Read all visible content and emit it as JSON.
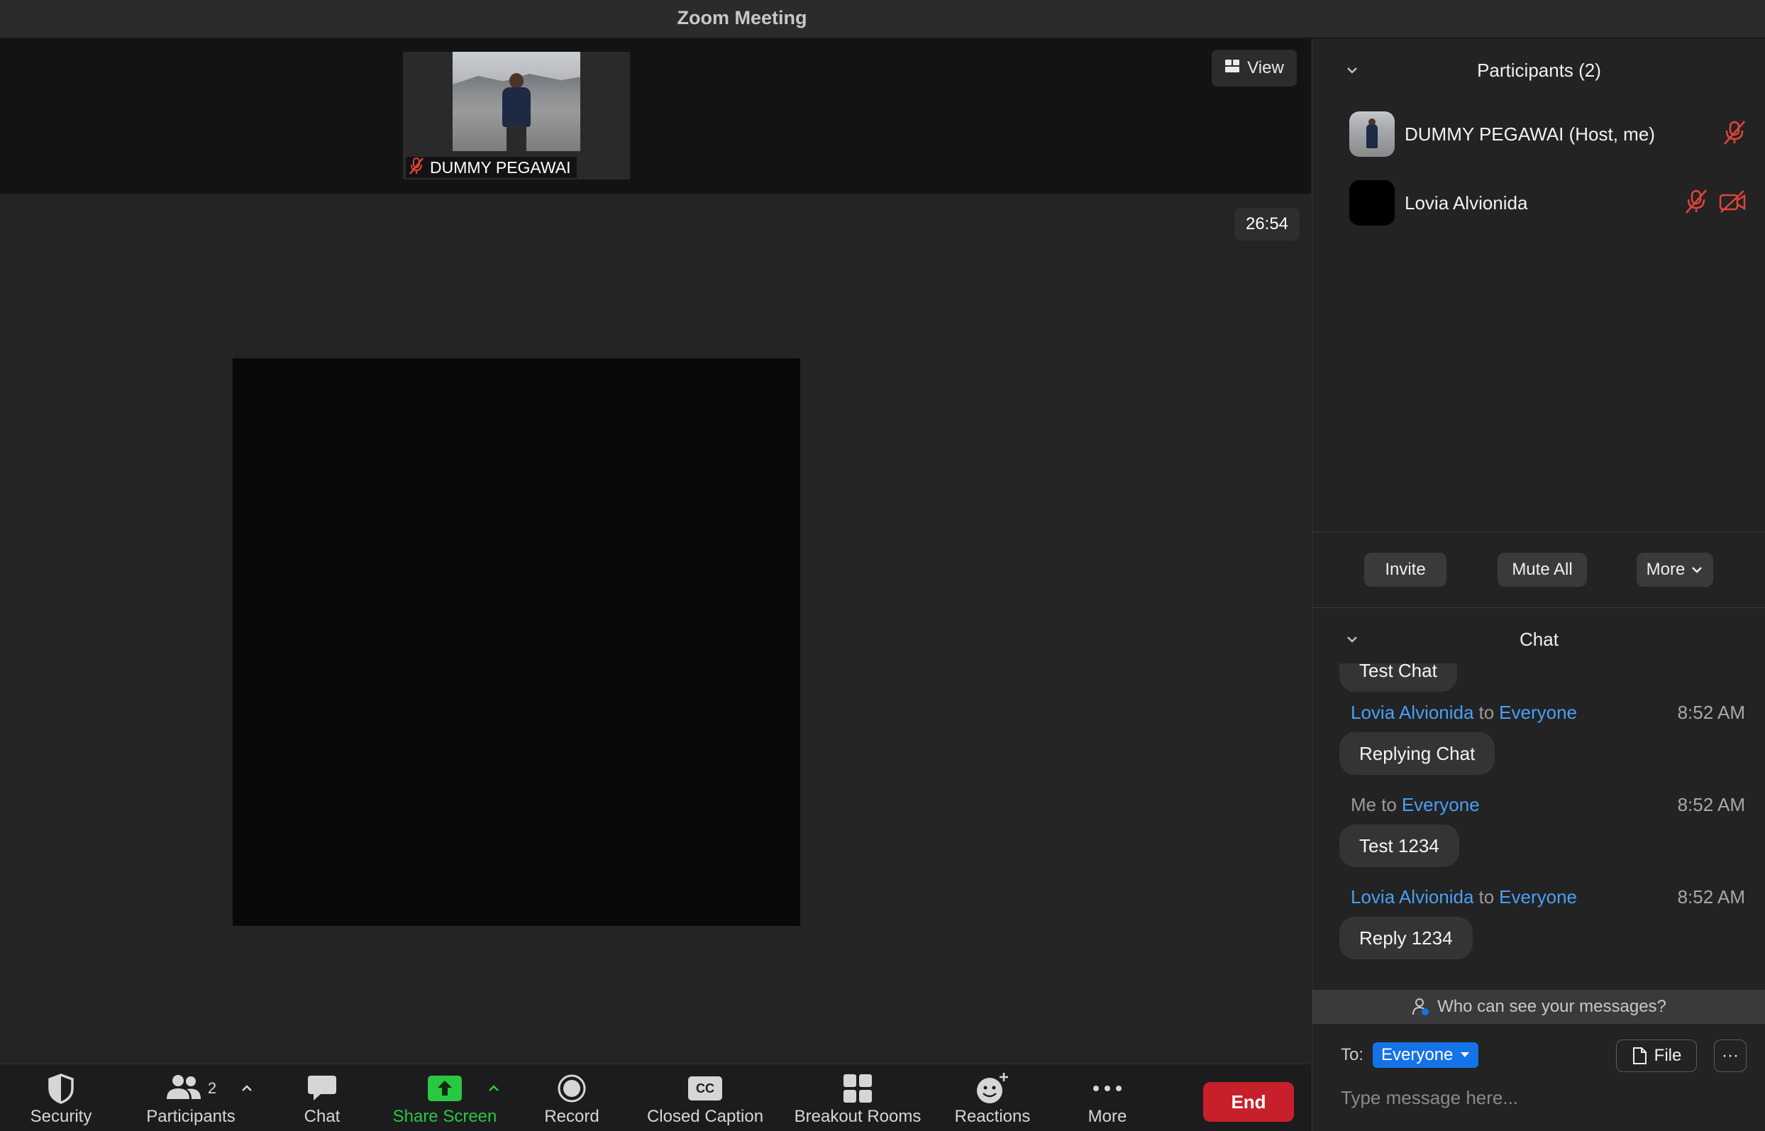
{
  "window": {
    "title": "Zoom Meeting"
  },
  "video": {
    "thumbnail_name": "DUMMY PEGAWAI",
    "view_label": "View",
    "timer": "26:54"
  },
  "toolbar": {
    "security": "Security",
    "participants": "Participants",
    "participants_count": "2",
    "chat": "Chat",
    "share_screen": "Share Screen",
    "record": "Record",
    "closed_caption": "Closed Caption",
    "cc_glyph": "CC",
    "breakout_rooms": "Breakout Rooms",
    "reactions": "Reactions",
    "more": "More",
    "end": "End"
  },
  "participants_panel": {
    "title": "Participants (2)",
    "items": [
      {
        "name": "DUMMY PEGAWAI (Host, me)"
      },
      {
        "name": "Lovia Alvionida"
      }
    ],
    "invite": "Invite",
    "mute_all": "Mute All",
    "more": "More"
  },
  "chat_panel": {
    "title": "Chat",
    "partial_message": "Test Chat",
    "messages": [
      {
        "sender": "Lovia Alvionida",
        "to": "to",
        "target": "Everyone",
        "time": "8:52 AM",
        "text": "Replying Chat"
      },
      {
        "sender": "Me",
        "to": "to",
        "target": "Everyone",
        "time": "8:52 AM",
        "text": "Test 1234"
      },
      {
        "sender": "Lovia Alvionida",
        "to": "to",
        "target": "Everyone",
        "time": "8:52 AM",
        "text": "Reply 1234"
      }
    ],
    "who_can_see": "Who can see your messages?",
    "to_label": "To:",
    "to_value": "Everyone",
    "file_label": "File",
    "more_glyph": "···",
    "input_placeholder": "Type message here..."
  },
  "colors": {
    "accent_blue": "#4a9ff5",
    "share_green": "#28c840",
    "end_red": "#c7202a",
    "muted_red": "#e0453a"
  }
}
